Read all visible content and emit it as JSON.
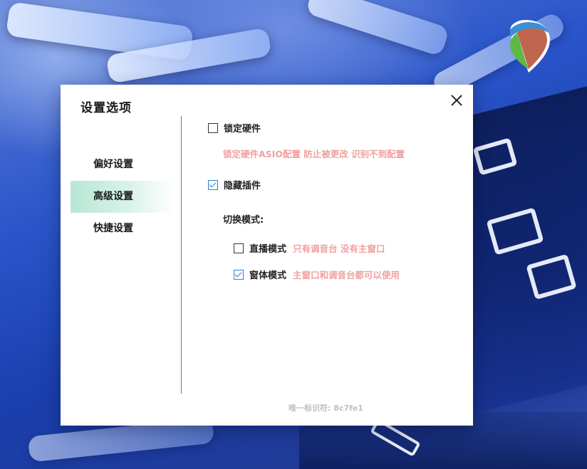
{
  "dialog": {
    "title": "设置选项"
  },
  "nav": {
    "items": [
      {
        "label": "偏好设置",
        "active": false
      },
      {
        "label": "高级设置",
        "active": true
      },
      {
        "label": "快捷设置",
        "active": false
      }
    ]
  },
  "advanced": {
    "lock_hardware": {
      "label": "锁定硬件",
      "checked": false
    },
    "lock_hardware_hint": "锁定硬件ASIO配置 防止被更改 识别不到配置",
    "hide_plugins": {
      "label": "隐藏插件",
      "checked": true
    },
    "switch_mode_label": "切换模式:",
    "modes": [
      {
        "label": "直播模式",
        "hint": "只有调音台 没有主窗口",
        "checked": false
      },
      {
        "label": "窗体模式",
        "hint": "主窗口和调音台都可以使用",
        "checked": true
      }
    ]
  },
  "footer": {
    "unique_id": "唯一标识符:  8c7fe1"
  },
  "colors": {
    "accent_check": "#2d7ed8",
    "hint_text": "#f0a0a0",
    "nav_active": "#b8e6d4"
  },
  "icons": {
    "close": "close-icon",
    "logo": "reaper-logo-icon"
  }
}
